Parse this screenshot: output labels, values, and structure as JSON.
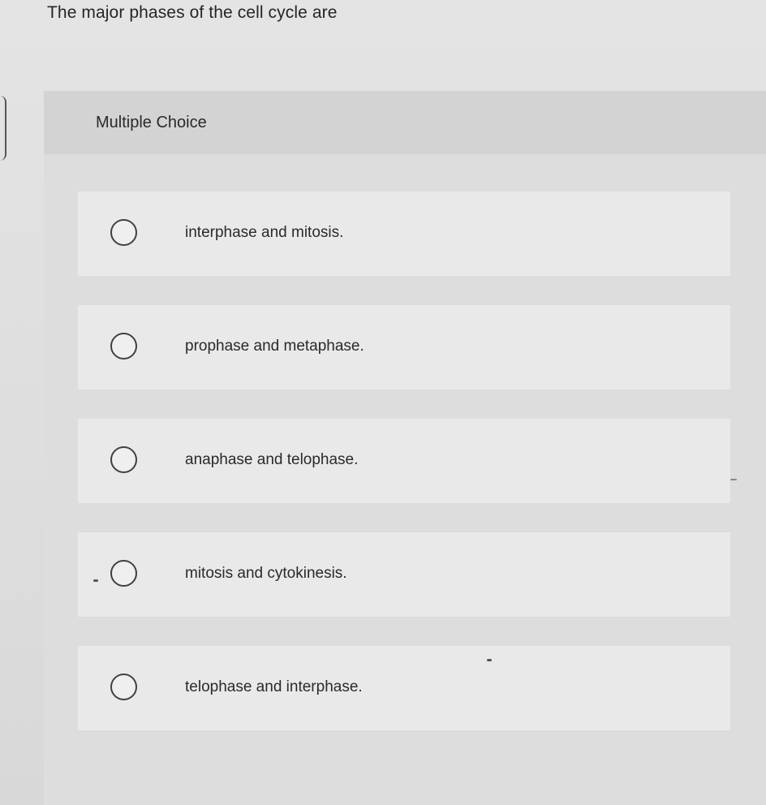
{
  "question": {
    "text": "The major phases of the cell cycle are"
  },
  "card": {
    "type_label": "Multiple Choice"
  },
  "options": [
    {
      "label": "interphase and mitosis."
    },
    {
      "label": "prophase and metaphase."
    },
    {
      "label": "anaphase and telophase."
    },
    {
      "label": "mitosis and cytokinesis."
    },
    {
      "label": "telophase and interphase."
    }
  ],
  "colors": {
    "page_background": "#e0e0e0",
    "header_background": "#d3d3d3",
    "option_background": "#e9e9e9",
    "radio_border": "#404040",
    "text": "#2a2a2a"
  },
  "icons": {
    "radio": "radio-unselected-icon"
  }
}
